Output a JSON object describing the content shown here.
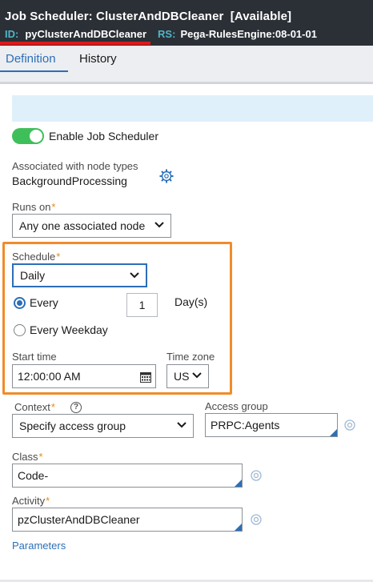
{
  "header": {
    "title": "Job Scheduler: ClusterAndDBCleaner",
    "status": "[Available]",
    "id_label": "ID:",
    "id_value": "pyClusterAndDBCleaner",
    "rs_label": "RS:",
    "rs_value": "Pega-RulesEngine:08-01-01"
  },
  "tabs": [
    {
      "label": "Definition",
      "active": true
    },
    {
      "label": "History",
      "active": false
    }
  ],
  "definition": {
    "enable_label": "Enable Job Scheduler",
    "enabled": true,
    "node_types_label": "Associated with node types",
    "node_types_value": "BackgroundProcessing",
    "runs_on_label": "Runs on",
    "runs_on_value": "Any one associated node",
    "schedule": {
      "label": "Schedule",
      "value": "Daily",
      "every_label": "Every",
      "every_value": "1",
      "every_unit": "Day(s)",
      "weekday_label": "Every Weekday",
      "selected": "Every"
    },
    "start_time_label": "Start time",
    "start_time_value": "12:00:00 AM",
    "time_zone_label": "Time zone",
    "time_zone_value": "US",
    "context_label": "Context",
    "context_value": "Specify access group",
    "access_group_label": "Access group",
    "access_group_value": "PRPC:Agents",
    "class_label": "Class",
    "class_value": "Code-",
    "activity_label": "Activity",
    "activity_value": "pzClusterAndDBCleaner",
    "parameters_link": "Parameters"
  },
  "colors": {
    "header_bg": "#2b2f36",
    "accent": "#2c6fb7",
    "toggle_on": "#3fbf5a",
    "highlight_box": "#f08c2b",
    "required": "#e38a1c"
  }
}
